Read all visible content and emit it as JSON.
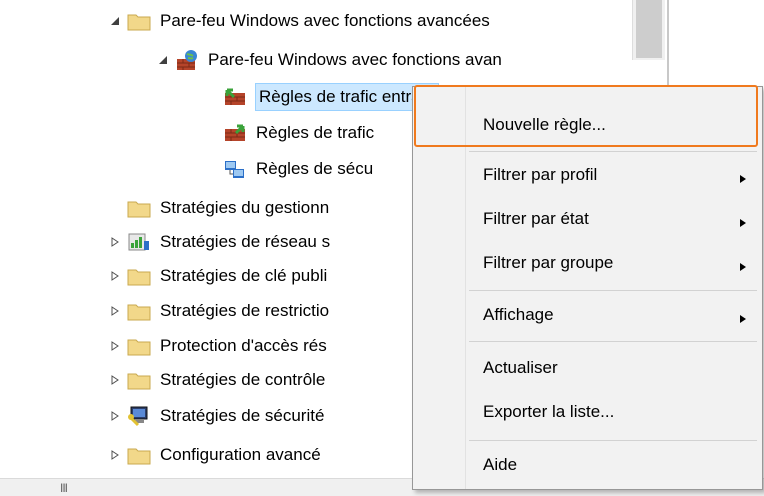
{
  "tree": {
    "items": [
      {
        "label": "Pare-feu Windows avec fonctions avancées",
        "expander": "expanded",
        "icon": "folder-icon"
      },
      {
        "label": "Pare-feu Windows avec fonctions avan",
        "expander": "expanded",
        "icon": "firewall-globe-icon"
      },
      {
        "label": "Règles de trafic entrant",
        "expander": "none",
        "icon": "inbound-rules-icon",
        "selected": true
      },
      {
        "label": "Règles de trafic",
        "expander": "none",
        "icon": "outbound-rules-icon"
      },
      {
        "label": "Règles de sécu",
        "expander": "none",
        "icon": "security-rules-icon"
      },
      {
        "label": "Stratégies du gestionn",
        "expander": "none",
        "icon": "folder-icon"
      },
      {
        "label": "Stratégies de réseau s",
        "expander": "collapsed",
        "icon": "network-chart-icon"
      },
      {
        "label": "Stratégies de clé publi",
        "expander": "collapsed",
        "icon": "folder-icon"
      },
      {
        "label": "Stratégies de restrictio",
        "expander": "collapsed",
        "icon": "folder-icon"
      },
      {
        "label": "Protection d'accès rés",
        "expander": "collapsed",
        "icon": "folder-icon"
      },
      {
        "label": "Stratégies de contrôle",
        "expander": "collapsed",
        "icon": "folder-icon"
      },
      {
        "label": "Stratégies de sécurité",
        "expander": "collapsed",
        "icon": "security-computer-icon"
      },
      {
        "label": "Configuration avancé",
        "expander": "collapsed",
        "icon": "folder-icon"
      }
    ]
  },
  "hscroll": {
    "grip": "III"
  },
  "context_menu": {
    "items": [
      {
        "label": "Nouvelle règle...",
        "submenu": false
      },
      {
        "label": "Filtrer par profil",
        "submenu": true
      },
      {
        "label": "Filtrer par état",
        "submenu": true
      },
      {
        "label": "Filtrer par groupe",
        "submenu": true
      },
      {
        "label": "Affichage",
        "submenu": true
      },
      {
        "label": "Actualiser",
        "submenu": false
      },
      {
        "label": "Exporter la liste...",
        "submenu": false
      },
      {
        "label": "Aide",
        "submenu": false
      }
    ]
  },
  "colors": {
    "highlight_border": "#f07a1e",
    "folder": "#f2d88a",
    "selection": "#cce8ff"
  }
}
